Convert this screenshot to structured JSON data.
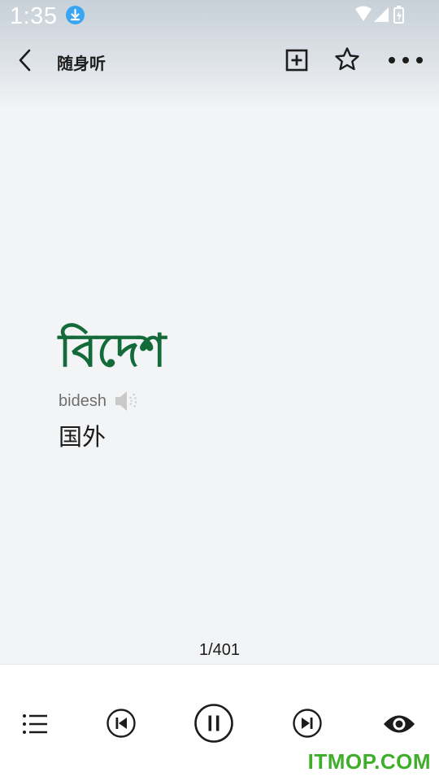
{
  "status_bar": {
    "time": "1:35",
    "download_icon": "download-icon",
    "wifi_icon": "wifi-icon",
    "signal_icon": "signal-icon",
    "battery_icon": "battery-charging-icon"
  },
  "header": {
    "title": "随身听",
    "back_icon": "chevron-left-icon",
    "add_icon": "add-box-icon",
    "favorite_icon": "star-outline-icon",
    "more_icon": "more-horiz-icon"
  },
  "card": {
    "word": "বিদেশ",
    "transliteration": "bidesh",
    "meaning": "国外",
    "accent_color": "#146b3a"
  },
  "progress": {
    "counter": "1/401"
  },
  "controls": {
    "list_icon": "playlist-icon",
    "previous_icon": "skip-previous-icon",
    "pause_icon": "pause-icon",
    "next_icon": "skip-next-icon",
    "eye_icon": "eye-icon"
  },
  "watermark": {
    "text": "ITMOP.COM",
    "color": "#3fae2a"
  }
}
